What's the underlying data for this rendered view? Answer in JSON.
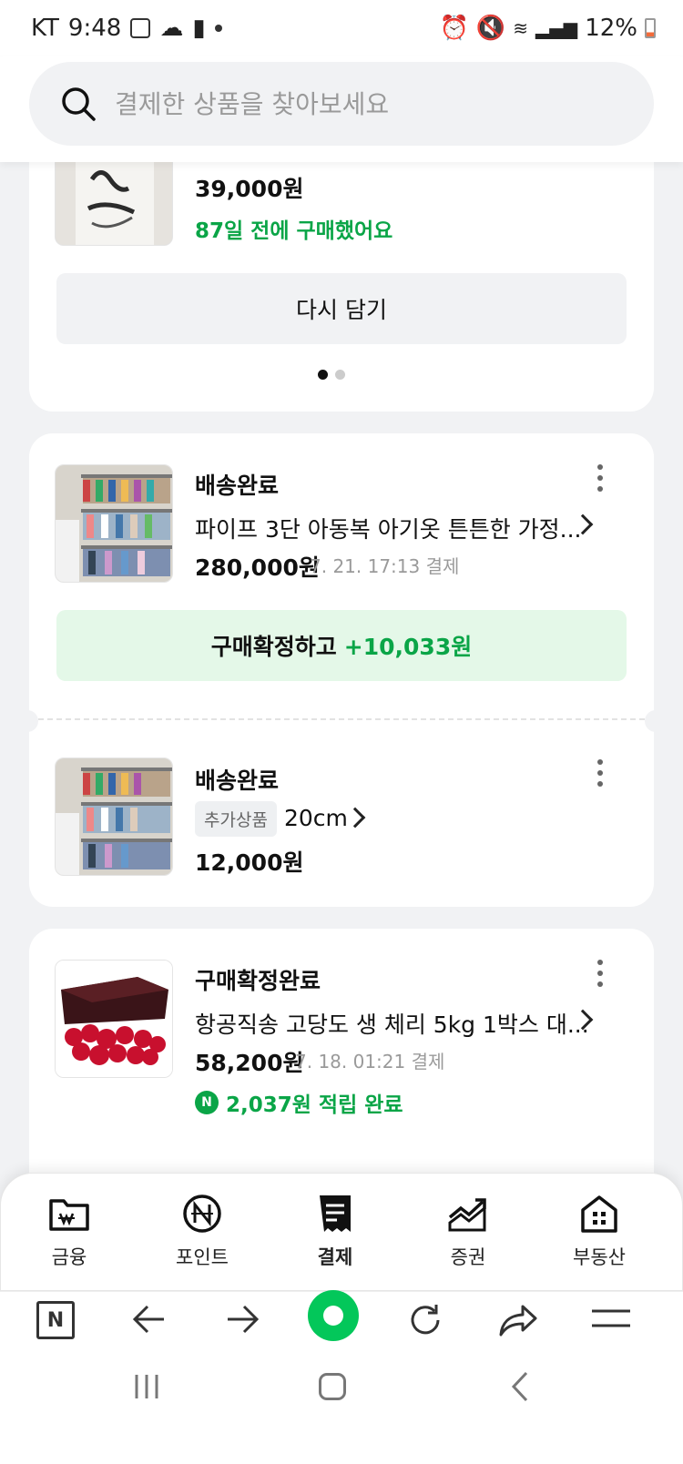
{
  "status_bar": {
    "carrier": "KT",
    "time": "9:48",
    "battery": "12%"
  },
  "search": {
    "placeholder": "결제한 상품을 찾아보세요"
  },
  "order1": {
    "price": "39,000원",
    "note": "87일 전에 구매했어요",
    "rebuy_label": "다시 담기"
  },
  "order2": {
    "status": "배송완료",
    "title": "파이프 3단 아동복 아기옷 튼튼한 가정...",
    "price": "280,000원",
    "date": "7. 21. 17:13 결제",
    "confirm_label": "구매확정하고",
    "confirm_reward": "+10,033원"
  },
  "order2_extra": {
    "status": "배송완료",
    "tag": "추가상품",
    "option": "20cm",
    "price": "12,000원"
  },
  "order3": {
    "status": "구매확정완료",
    "title": "항공직송 고당도 생 체리 5kg 1박스 대...",
    "price": "58,200원",
    "date": "7. 18. 01:21 결제",
    "reward": "2,037원 적립 완료"
  },
  "bottom_nav": {
    "items": [
      {
        "label": "금융"
      },
      {
        "label": "포인트"
      },
      {
        "label": "결제"
      },
      {
        "label": "증권"
      },
      {
        "label": "부동산"
      }
    ]
  },
  "colors": {
    "accent_green": "#0aa547",
    "confirm_bg": "#e4f8e8",
    "browser_green": "#03c75a"
  }
}
